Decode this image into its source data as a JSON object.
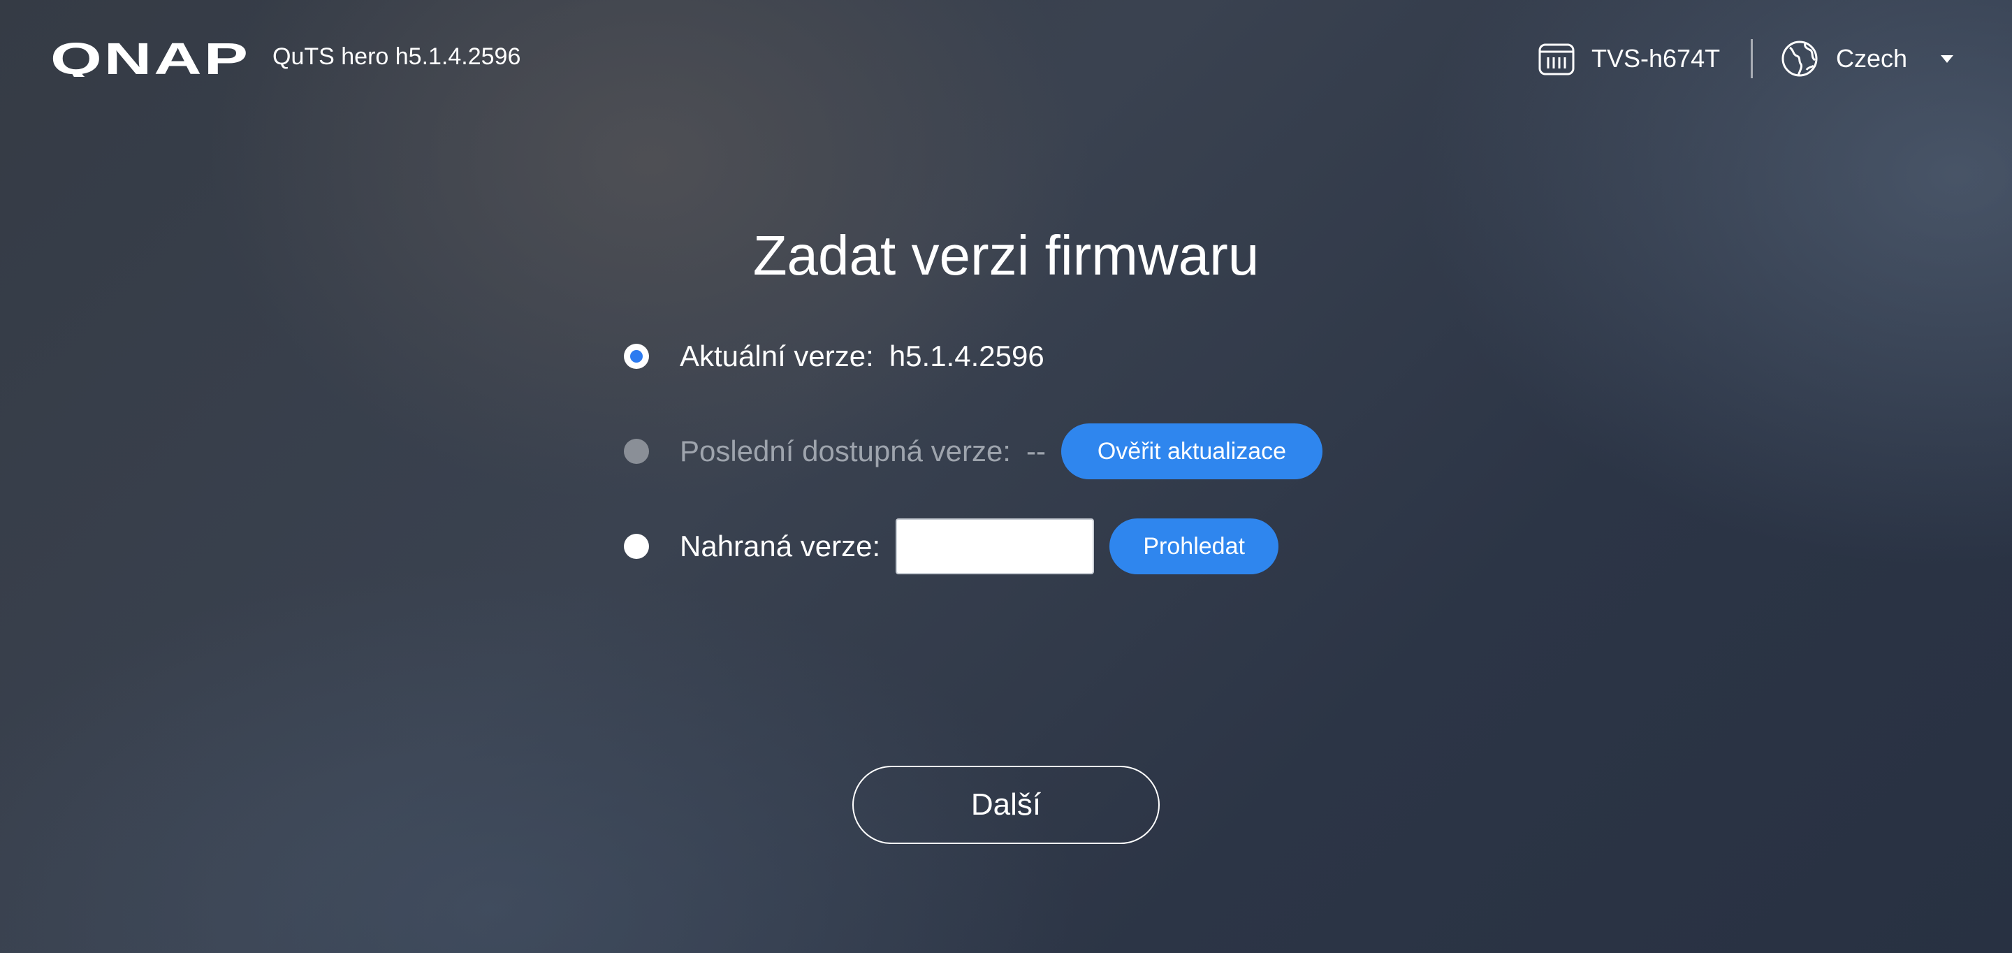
{
  "header": {
    "logo_text": "QNAP",
    "product_version": "QuTS hero h5.1.4.2596",
    "device_name": "TVS-h674T",
    "device_icon": "nas-device-icon",
    "language_icon": "globe-icon",
    "language": "Czech"
  },
  "main": {
    "title": "Zadat verzi firmwaru",
    "options": [
      {
        "label": "Aktuální verze:",
        "value": "h5.1.4.2596",
        "selected": true,
        "disabled": false
      },
      {
        "label": "Poslední dostupná verze:",
        "value": "--",
        "selected": false,
        "disabled": true,
        "button_label": "Ověřit aktualizace"
      },
      {
        "label": "Nahraná verze:",
        "input_value": "",
        "input_placeholder": "",
        "selected": false,
        "disabled": false,
        "button_label": "Prohledat"
      }
    ],
    "next_label": "Další"
  },
  "colors": {
    "accent": "#2f86ee",
    "radio_selected": "#2d7bf0",
    "disabled_text": "#9ea4ad"
  }
}
